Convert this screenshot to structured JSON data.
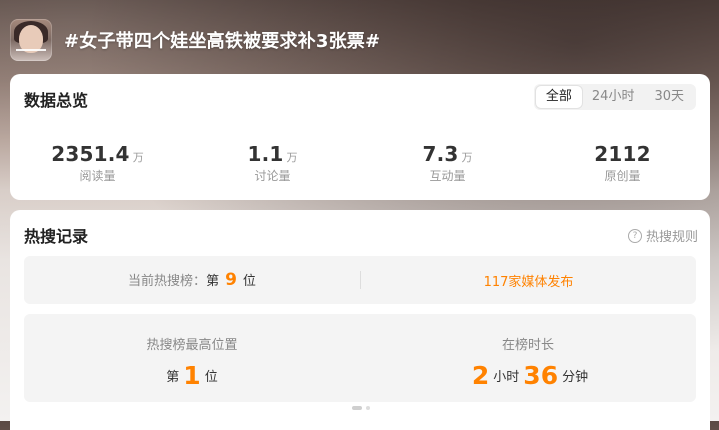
{
  "header": {
    "title": "#女子带四个娃坐高铁被要求补3张票#",
    "avatar_icon": "portrait-thumbnail"
  },
  "overview": {
    "title": "数据总览",
    "tabs": [
      {
        "label": "全部",
        "active": true
      },
      {
        "label": "24小时",
        "active": false
      },
      {
        "label": "30天",
        "active": false
      }
    ],
    "stats": [
      {
        "value": "2351.4",
        "unit": "万",
        "label": "阅读量"
      },
      {
        "value": "1.1",
        "unit": "万",
        "label": "讨论量"
      },
      {
        "value": "7.3",
        "unit": "万",
        "label": "互动量"
      },
      {
        "value": "2112",
        "unit": "",
        "label": "原创量"
      }
    ]
  },
  "records": {
    "title": "热搜记录",
    "rules_label": "热搜规则",
    "current_rank": {
      "prefix": "当前热搜榜：",
      "pre": "第",
      "value": "9",
      "post": "位"
    },
    "media_label": "117家媒体发布",
    "best_position": {
      "label": "热搜榜最高位置",
      "pre": "第",
      "value": "1",
      "post": "位"
    },
    "duration": {
      "label": "在榜时长",
      "hours": "2",
      "hours_unit": "小时",
      "minutes": "36",
      "minutes_unit": "分钟"
    }
  },
  "colors": {
    "accent": "#ff8200",
    "card": "#ffffff",
    "panel": "#f4f4f4"
  }
}
